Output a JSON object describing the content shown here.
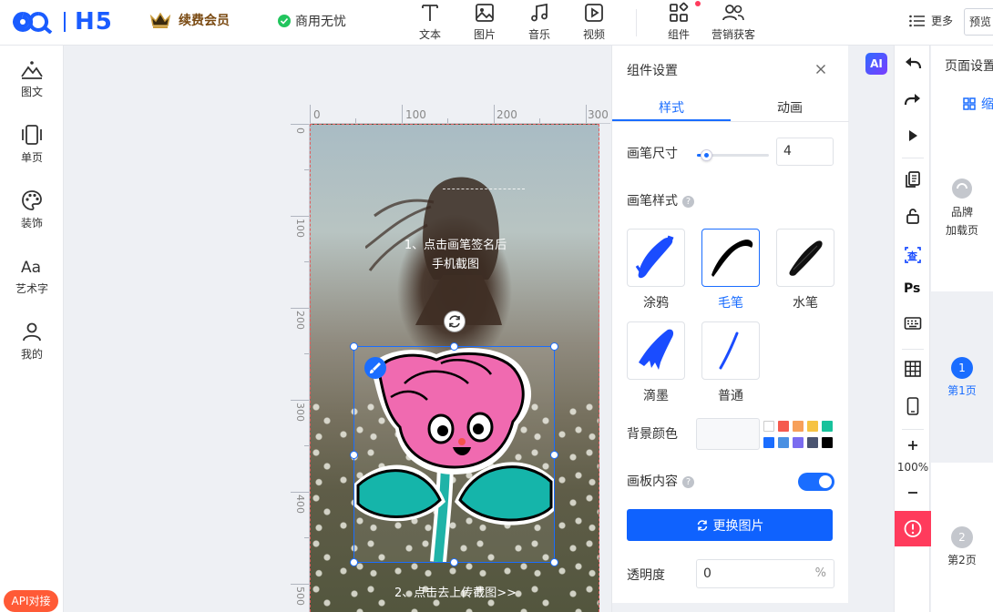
{
  "topbar": {
    "logo_text": "H5",
    "vip_label": "续费会员",
    "commercial_label": "商用无忧",
    "tools": [
      {
        "label": "文本",
        "icon": "text-icon"
      },
      {
        "label": "图片",
        "icon": "image-icon"
      },
      {
        "label": "音乐",
        "icon": "music-icon"
      },
      {
        "label": "视频",
        "icon": "video-icon"
      },
      {
        "label": "组件",
        "icon": "component-icon"
      },
      {
        "label": "营销获客",
        "icon": "users-icon"
      }
    ],
    "more_label": "更多",
    "preview_label": "预览"
  },
  "leftbar": {
    "items": [
      {
        "label": "图文"
      },
      {
        "label": "单页"
      },
      {
        "label": "装饰"
      },
      {
        "label": "艺术字"
      },
      {
        "label": "我的"
      }
    ],
    "api_label": "API对接"
  },
  "ruler": {
    "h_labels": [
      "0",
      "100",
      "200",
      "300"
    ],
    "v_labels": [
      "0",
      "100",
      "200",
      "300",
      "400",
      "500"
    ]
  },
  "canvas": {
    "hint1_line1": "1、点击画笔签名后",
    "hint1_line2": "手机截图",
    "hint2": "2、点击去上传截图>>"
  },
  "panel": {
    "title": "组件设置",
    "tab_style": "样式",
    "tab_anim": "动画",
    "brush_size_label": "画笔尺寸",
    "brush_size_value": "4",
    "brush_size_fraction": 0.05,
    "brush_style_label": "画笔样式",
    "brushes": [
      {
        "name": "涂鸦",
        "active": false
      },
      {
        "name": "毛笔",
        "active": true
      },
      {
        "name": "水笔",
        "active": false
      },
      {
        "name": "滴墨",
        "active": false
      },
      {
        "name": "普通",
        "active": false
      }
    ],
    "bg_color_label": "背景颜色",
    "swatches": [
      "#ffffff",
      "#f55a4e",
      "#f7a05a",
      "#f6c343",
      "#18c29c",
      "#1a6dff",
      "#4a90e2",
      "#7b6cf0",
      "#4a5470",
      "#000000"
    ],
    "canvas_content_label": "画板内容",
    "canvas_content_on": true,
    "replace_label": "更换图片",
    "opacity_label": "透明度",
    "opacity_value": "0",
    "opacity_unit": "%"
  },
  "righttools": {
    "ai_label": "AI",
    "ps_label": "Ps",
    "zoom": "100%"
  },
  "pagecol": {
    "title": "页面设置",
    "tab_label": "缩",
    "loading_line1": "品牌",
    "loading_line2": "加载页",
    "page1_num": "1",
    "page1_label": "第1页",
    "page2_num": "2",
    "page2_label": "第2页"
  }
}
